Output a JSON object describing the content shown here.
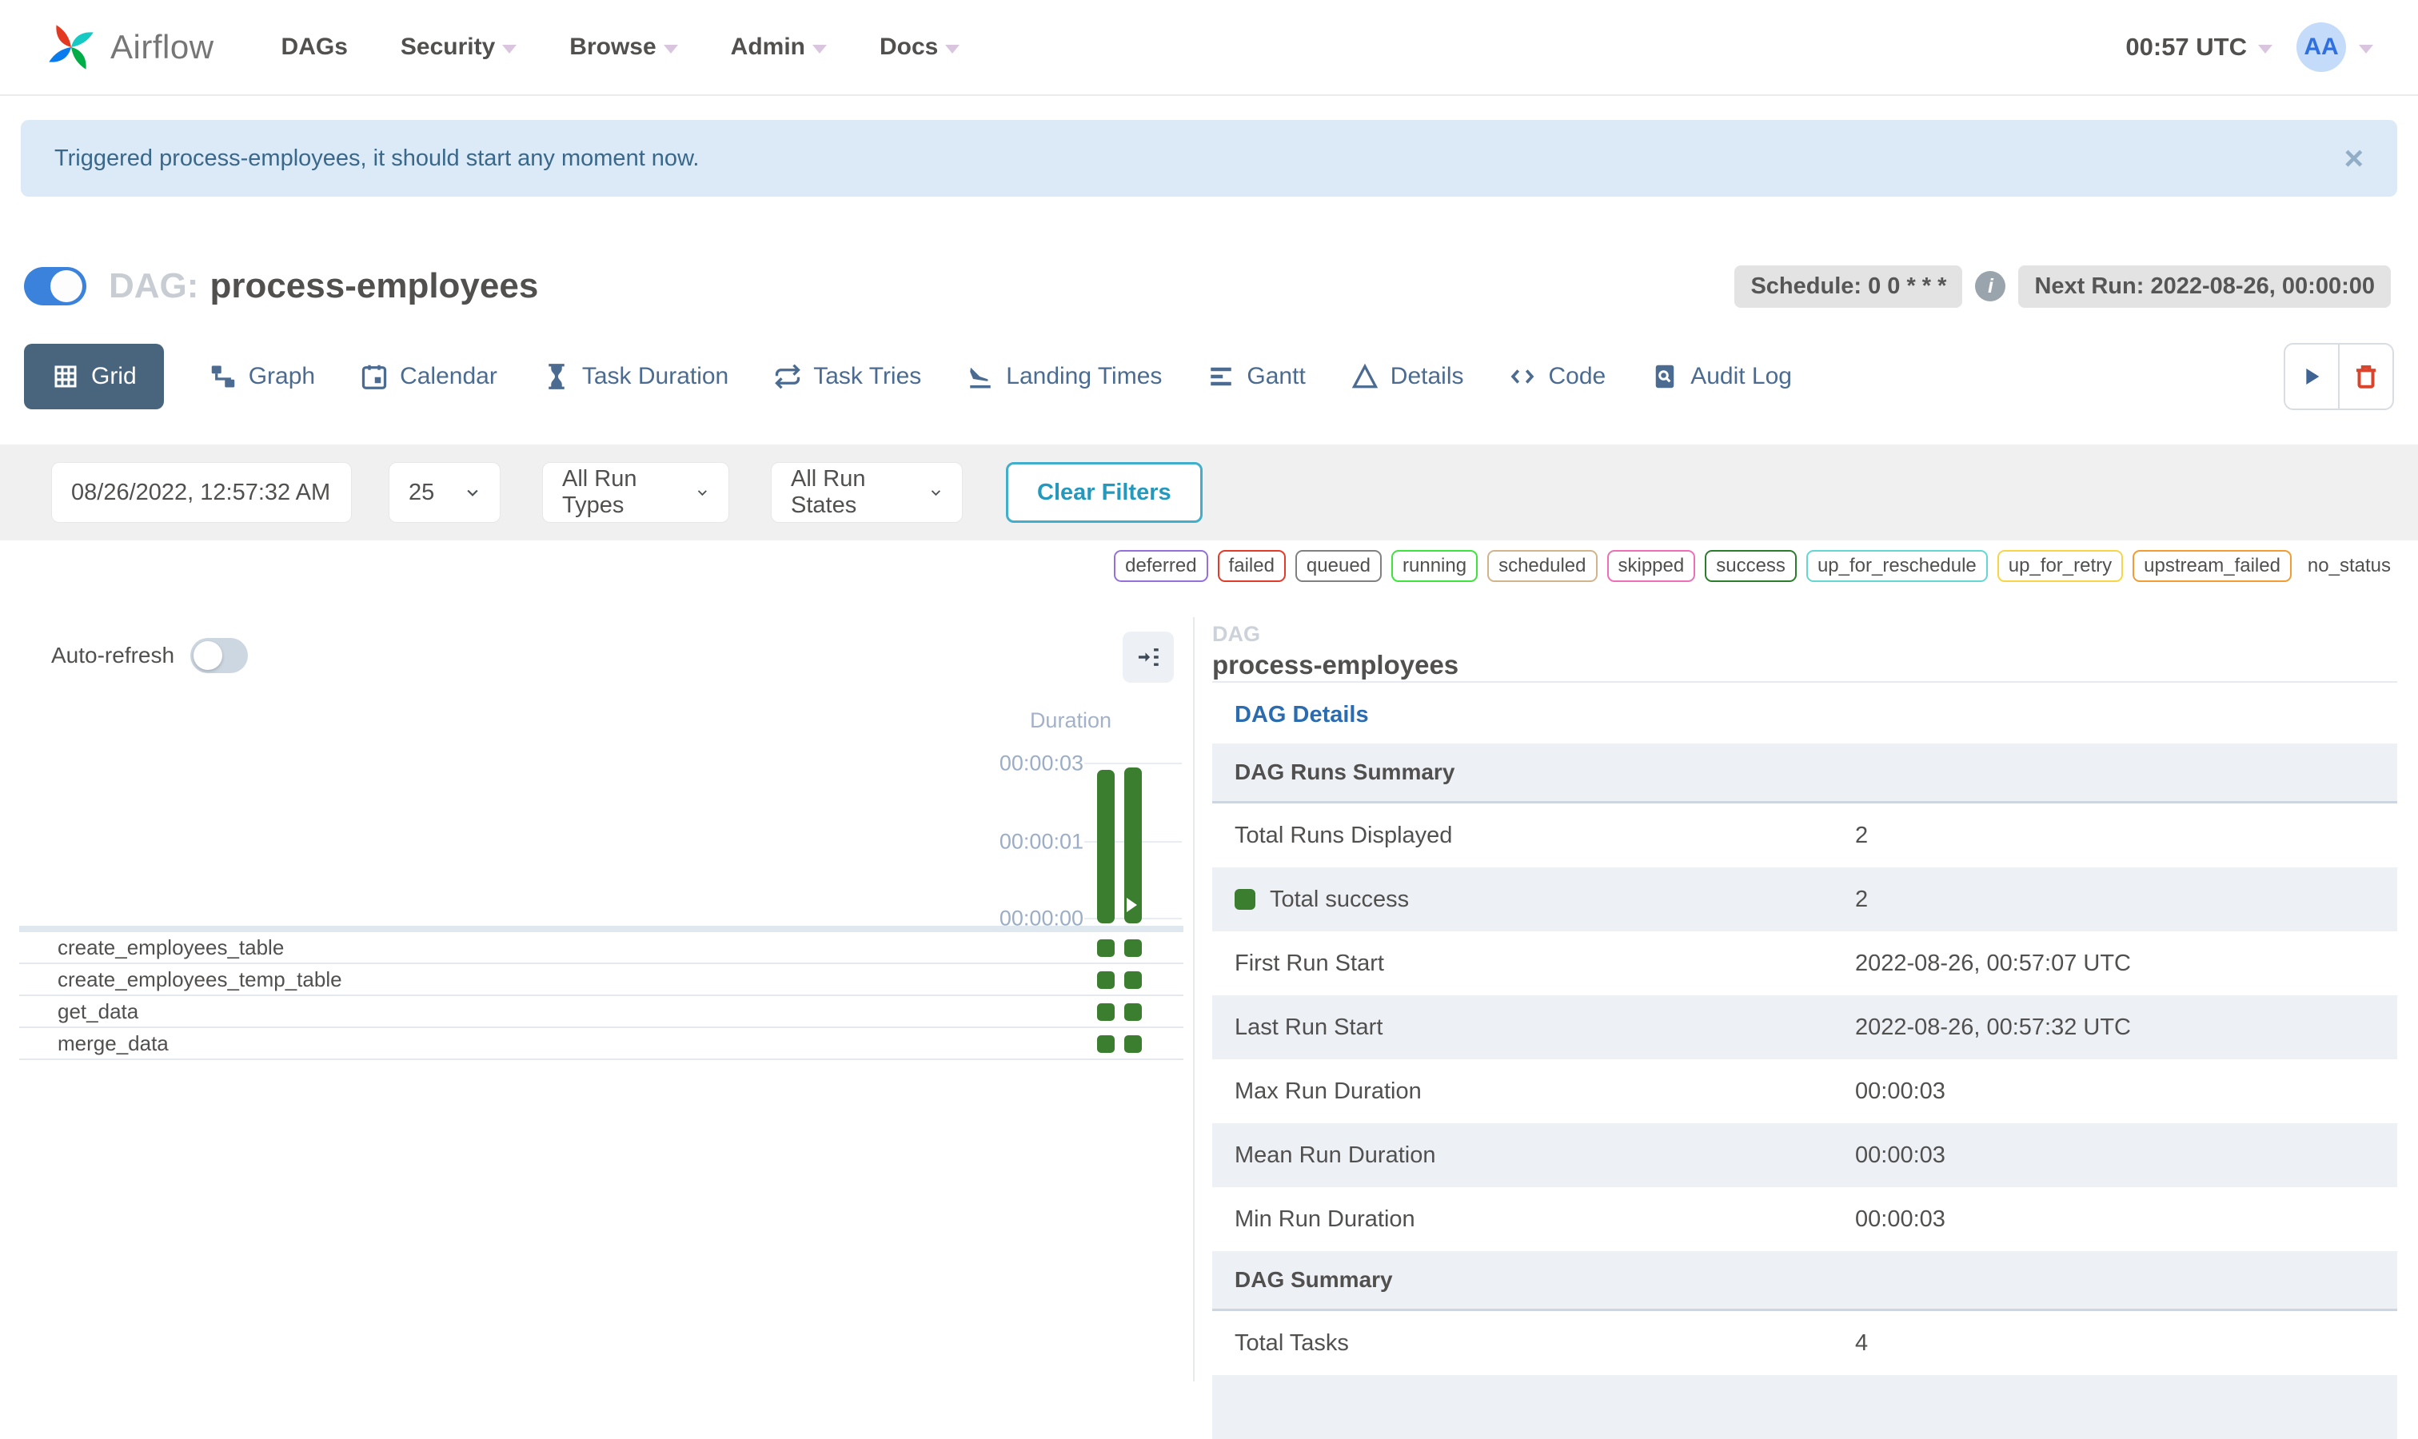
{
  "navbar": {
    "brand": "Airflow",
    "items": [
      {
        "label": "DAGs",
        "caret": false
      },
      {
        "label": "Security",
        "caret": true
      },
      {
        "label": "Browse",
        "caret": true
      },
      {
        "label": "Admin",
        "caret": true
      },
      {
        "label": "Docs",
        "caret": true
      }
    ],
    "clock": "00:57 UTC",
    "avatar_initials": "AA"
  },
  "alert": {
    "message": "Triggered process-employees, it should start any moment now.",
    "close": "×"
  },
  "dag": {
    "label": "DAG:",
    "name": "process-employees",
    "schedule_badge": "Schedule: 0 0 * * *",
    "info_icon": "i",
    "next_run_badge": "Next Run: 2022-08-26, 00:00:00"
  },
  "tabs": {
    "grid": "Grid",
    "graph": "Graph",
    "calendar": "Calendar",
    "task_duration": "Task Duration",
    "task_tries": "Task Tries",
    "landing_times": "Landing Times",
    "gantt": "Gantt",
    "details": "Details",
    "code": "Code",
    "audit_log": "Audit Log"
  },
  "filters": {
    "date_value": "08/26/2022, 12:57:32 AM",
    "page_size": "25",
    "run_types": "All Run Types",
    "run_states": "All Run States",
    "clear_label": "Clear Filters"
  },
  "legend": {
    "statuses": [
      {
        "label": "deferred",
        "color": "#9370db"
      },
      {
        "label": "failed",
        "color": "#e43a2a"
      },
      {
        "label": "queued",
        "color": "#808080"
      },
      {
        "label": "running",
        "color": "#3ce43c"
      },
      {
        "label": "scheduled",
        "color": "#d2b48c"
      },
      {
        "label": "skipped",
        "color": "#ee6fb5"
      },
      {
        "label": "success",
        "color": "#2b7d2b"
      },
      {
        "label": "up_for_reschedule",
        "color": "#63d8d3"
      },
      {
        "label": "up_for_retry",
        "color": "#f7d547"
      },
      {
        "label": "upstream_failed",
        "color": "#f29c33"
      }
    ],
    "no_status_label": "no_status"
  },
  "grid": {
    "auto_refresh_label": "Auto-refresh",
    "duration_label": "Duration",
    "ticks": [
      "00:00:03",
      "00:00:01",
      "00:00:00"
    ],
    "bar_color": "#3c7e2f",
    "runs": [
      {
        "duration": "00:00:03",
        "state": "success",
        "manually_triggered": false
      },
      {
        "duration": "00:00:03",
        "state": "success",
        "manually_triggered": true
      }
    ],
    "tasks": [
      "create_employees_table",
      "create_employees_temp_table",
      "get_data",
      "merge_data"
    ]
  },
  "details": {
    "panel_label": "DAG",
    "dag_name": "process-employees",
    "link": "DAG Details",
    "table": {
      "rows": [
        {
          "label": "DAG Runs Summary"
        },
        {
          "label": "Total Runs Displayed",
          "value": "2"
        },
        {
          "label": "Total success",
          "value": "2",
          "swatch": "#3c7e2f"
        },
        {
          "label": "First Run Start",
          "value": "2022-08-26, 00:57:07 UTC"
        },
        {
          "label": "Last Run Start",
          "value": "2022-08-26, 00:57:32 UTC"
        },
        {
          "label": "Max Run Duration",
          "value": "00:00:03"
        },
        {
          "label": "Mean Run Duration",
          "value": "00:00:03"
        },
        {
          "label": "Min Run Duration",
          "value": "00:00:03"
        },
        {
          "label": "DAG Summary"
        },
        {
          "label": "Total Tasks",
          "value": "4"
        }
      ]
    }
  }
}
